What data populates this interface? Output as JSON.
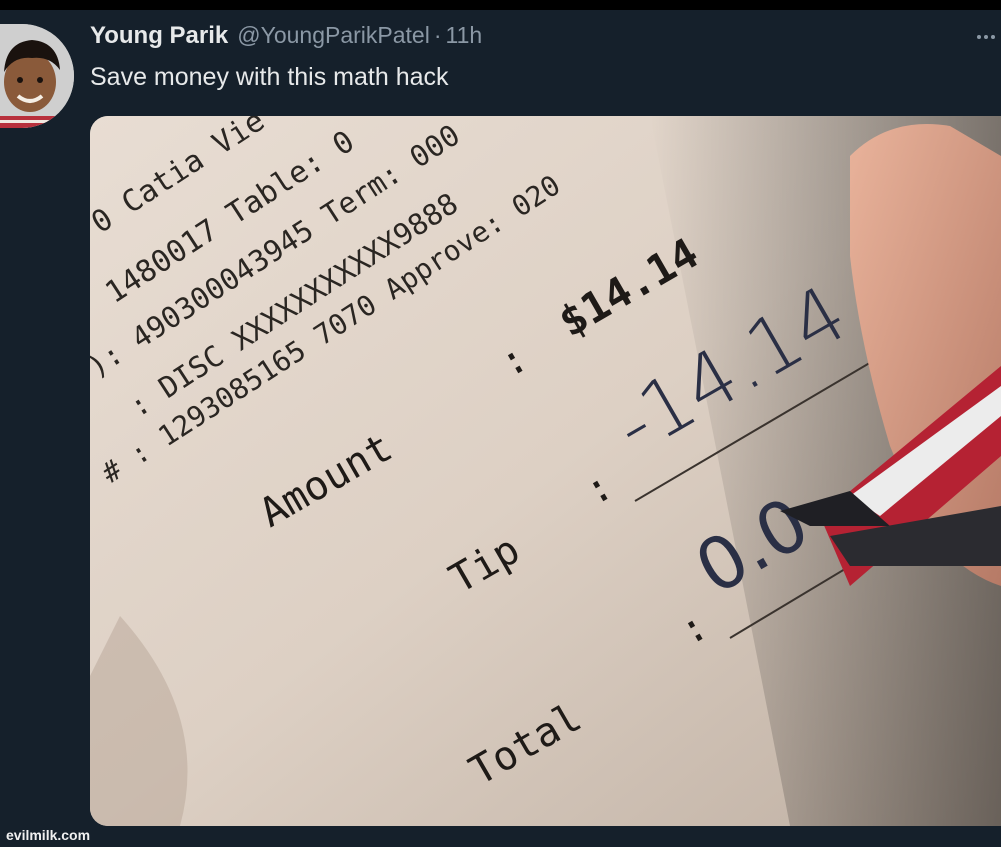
{
  "tweet": {
    "display_name": "Young Parik",
    "handle": "@YoungParikPatel",
    "separator": "·",
    "time": "11h",
    "text": "Save money with this math hack",
    "more_icon": "ellipsis-icon"
  },
  "receipt": {
    "line1": "0 Catia Vie",
    "line2": "1480017  Table: 0",
    "line3": "): 490300043945 Term: 000",
    "line4": ": DISC XXXXXXXXXXX9888",
    "line5": "# : 1293085165 7070  Approve: 020",
    "amount_label": "Amount",
    "amount_colon": ":",
    "amount_value": "$14.14",
    "tip_label": "Tip",
    "tip_colon": ":",
    "tip_handwritten": "-14.14",
    "total_label": "Total",
    "total_colon": ":",
    "total_handwritten": "0.0"
  },
  "watermark": "evilmilk.com"
}
